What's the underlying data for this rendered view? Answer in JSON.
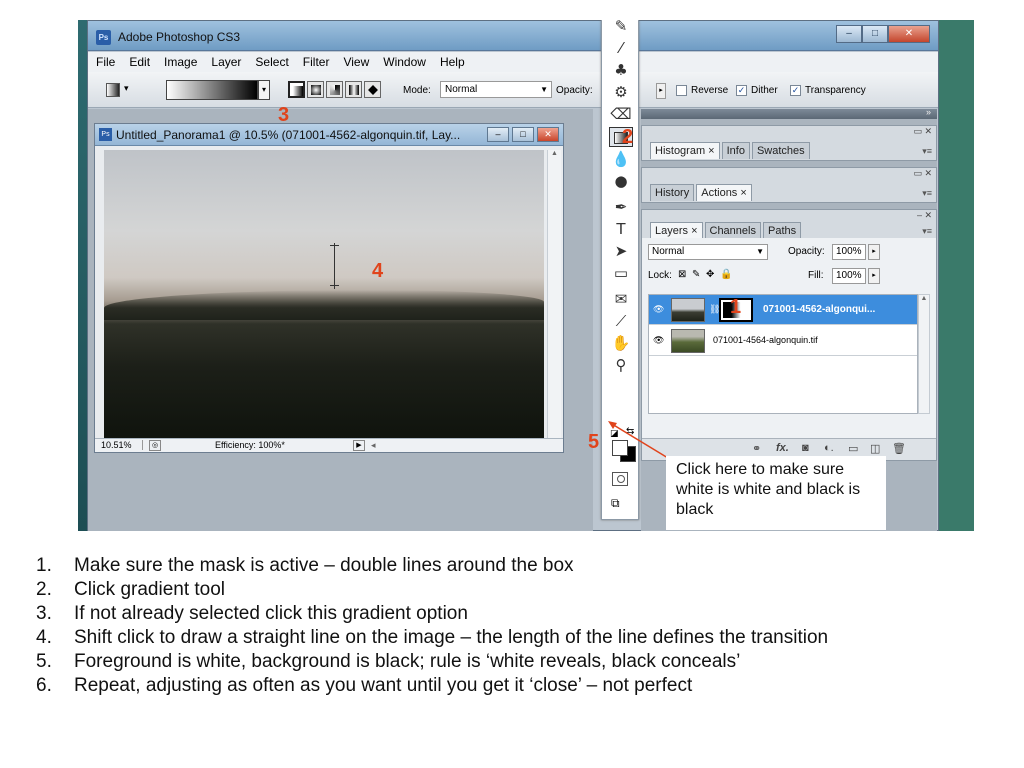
{
  "app": {
    "title": "Adobe Photoshop CS3",
    "icon_label": "Ps",
    "window_buttons": [
      "–",
      "□",
      "✕"
    ]
  },
  "menu": [
    "File",
    "Edit",
    "Image",
    "Layer",
    "Select",
    "Filter",
    "View",
    "Window",
    "Help"
  ],
  "options": {
    "mode_label": "Mode:",
    "mode_value": "Normal",
    "opacity_label": "Opacity:",
    "reverse_label": "Reverse",
    "reverse_checked": false,
    "dither_label": "Dither",
    "dither_checked": true,
    "transparency_label": "Transparency",
    "transparency_checked": true,
    "gradient_types": [
      "linear",
      "radial",
      "angle",
      "reflected",
      "diamond"
    ],
    "selected_gradient_type": "linear"
  },
  "document": {
    "title": "Untitled_Panorama1 @ 10.5% (071001-4562-algonquin.tif, Lay...",
    "icon_label": "Ps",
    "zoom": "10.51%",
    "efficiency": "Efficiency: 100%*"
  },
  "panels": {
    "group1_tabs": [
      "Histogram ×",
      "Info",
      "Swatches"
    ],
    "group2_tabs": [
      "History",
      "Actions ×"
    ],
    "layers_tabs": [
      "Layers ×",
      "Channels",
      "Paths"
    ],
    "blend_mode": "Normal",
    "opacity_label": "Opacity:",
    "opacity_value": "100%",
    "lock_label": "Lock:",
    "fill_label": "Fill:",
    "fill_value": "100%",
    "layers": [
      {
        "name": "071001-4562-algonqui...",
        "selected": true,
        "has_mask": true
      },
      {
        "name": "071001-4564-algonquin.tif",
        "selected": false,
        "has_mask": false
      }
    ],
    "footer_icons": [
      "link-icon",
      "fx-icon",
      "mask-icon",
      "adjustment-icon",
      "folder-icon",
      "new-layer-icon",
      "trash-icon"
    ]
  },
  "tools": {
    "active": "gradient-tool",
    "foreground_color": "#ffffff",
    "background_color": "#000000"
  },
  "annotations": {
    "tag1": "1",
    "tag2": "2",
    "tag3": "3",
    "tag4": "4",
    "tag5": "5",
    "callout": "Click here to make sure white is white and black is black",
    "color": "#e0441c"
  },
  "notes": [
    {
      "num": "1.",
      "text": "Make sure the mask is active – double lines around the box"
    },
    {
      "num": "2.",
      "text": "Click gradient tool"
    },
    {
      "num": "3.",
      "text": "If not already selected click this gradient option"
    },
    {
      "num": "4.",
      "text": "Shift click to draw a straight line on the image – the length of the line defines the transition"
    },
    {
      "num": "5.",
      "text": "Foreground is white, background is black; rule is ‘white reveals, black conceals’"
    },
    {
      "num": "6.",
      "text": "Repeat, adjusting as often as you want until you get it ‘close’ – not perfect"
    }
  ]
}
